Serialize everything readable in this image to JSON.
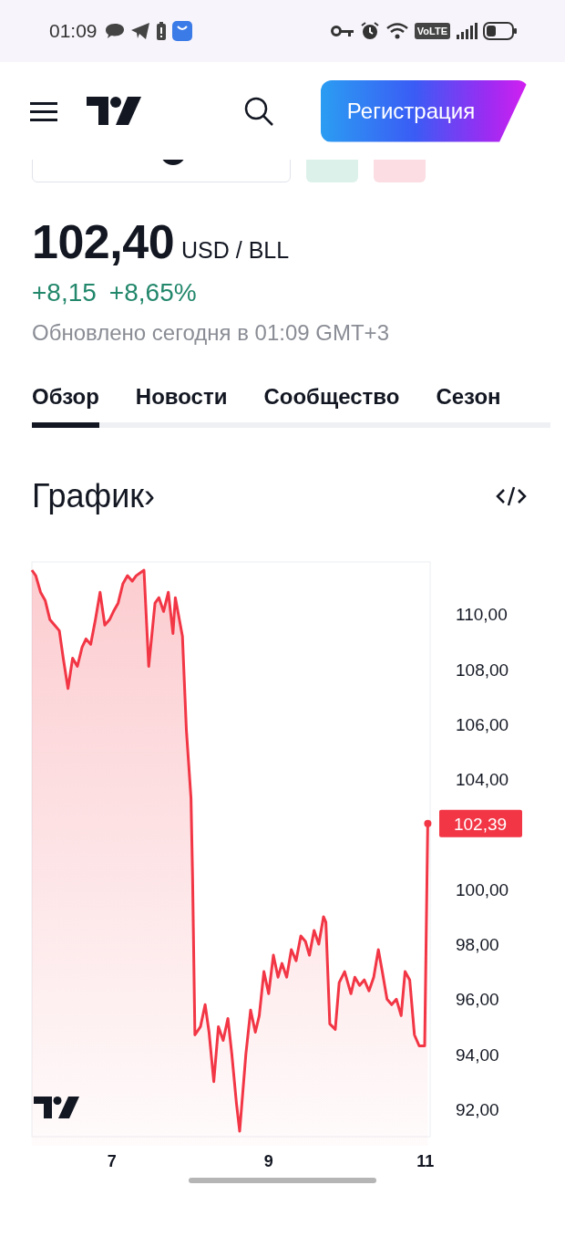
{
  "status_bar": {
    "time": "01:09",
    "network_badge": "VoLTE"
  },
  "header": {
    "register_button": "Регистрация"
  },
  "quote": {
    "price": "102,40",
    "unit": "USD / BLL",
    "change": "+8,15",
    "change_percent": "+8,65%",
    "updated": "Обновлено сегодня в 01:09 GMT+3"
  },
  "tabs": [
    {
      "label": "Обзор",
      "selected": true
    },
    {
      "label": "Новости",
      "selected": false
    },
    {
      "label": "Сообщество",
      "selected": false
    },
    {
      "label": "Сезон",
      "selected": false
    }
  ],
  "chart_section": {
    "title": "График",
    "title_arrow": "›",
    "chart_data": {
      "type": "area",
      "xlim": [
        5.98,
        11.06
      ],
      "ylim": [
        91.0,
        111.9
      ],
      "xticks": [
        {
          "value": 7,
          "label": "7"
        },
        {
          "value": 9,
          "label": "9"
        },
        {
          "value": 11,
          "label": "11"
        }
      ],
      "yticks": [
        {
          "value": 92,
          "label": "92,00"
        },
        {
          "value": 94,
          "label": "94,00"
        },
        {
          "value": 96,
          "label": "96,00"
        },
        {
          "value": 98,
          "label": "98,00"
        },
        {
          "value": 100,
          "label": "100,00"
        },
        {
          "value": 104,
          "label": "104,00"
        },
        {
          "value": 106,
          "label": "106,00"
        },
        {
          "value": 108,
          "label": "108,00"
        },
        {
          "value": 110,
          "label": "110,00"
        }
      ],
      "x": [
        5.98,
        6.03,
        6.09,
        6.15,
        6.21,
        6.27,
        6.33,
        6.38,
        6.44,
        6.5,
        6.56,
        6.62,
        6.67,
        6.73,
        6.79,
        6.85,
        6.91,
        6.97,
        7.02,
        7.08,
        7.14,
        7.2,
        7.26,
        7.31,
        7.41,
        7.47,
        7.55,
        7.6,
        7.66,
        7.72,
        7.78,
        7.81,
        7.9,
        7.95,
        8.01,
        8.03,
        8.06,
        8.13,
        8.19,
        8.24,
        8.3,
        8.36,
        8.42,
        8.48,
        8.53,
        8.59,
        8.63,
        8.71,
        8.77,
        8.83,
        8.88,
        8.94,
        9.0,
        9.06,
        9.12,
        9.17,
        9.23,
        9.29,
        9.35,
        9.41,
        9.47,
        9.52,
        9.58,
        9.64,
        9.7,
        9.73,
        9.78,
        9.85,
        9.9,
        9.97,
        10.05,
        10.1,
        10.16,
        10.22,
        10.28,
        10.34,
        10.4,
        10.45,
        10.51,
        10.57,
        10.63,
        10.69,
        10.74,
        10.8,
        10.86,
        10.92,
        10.99,
        11.03
      ],
      "series": [
        {
          "color": "#f23645",
          "values": [
            111.6,
            111.4,
            110.8,
            110.5,
            109.8,
            109.6,
            109.4,
            108.4,
            107.3,
            108.4,
            108.1,
            108.8,
            109.1,
            108.9,
            109.8,
            110.8,
            109.6,
            109.8,
            110.1,
            110.4,
            111.1,
            111.4,
            111.2,
            111.4,
            111.6,
            108.1,
            110.4,
            110.6,
            110.1,
            110.8,
            109.3,
            110.6,
            109.2,
            105.8,
            103.3,
            100.5,
            94.7,
            95.0,
            95.8,
            94.8,
            93.0,
            95.0,
            94.5,
            95.3,
            94.0,
            92.2,
            91.2,
            94.0,
            95.6,
            94.8,
            95.4,
            97.0,
            96.2,
            97.6,
            96.8,
            97.3,
            96.8,
            97.8,
            97.4,
            98.3,
            98.1,
            97.6,
            98.5,
            98.0,
            99.0,
            98.8,
            95.1,
            94.9,
            96.6,
            97.0,
            96.2,
            96.8,
            96.5,
            96.7,
            96.3,
            96.8,
            97.8,
            97.0,
            96.0,
            95.8,
            96.0,
            95.4,
            97.0,
            96.7,
            94.7,
            94.3,
            94.3,
            102.39
          ]
        }
      ],
      "annotations": [
        {
          "text": "102,39"
        }
      ]
    }
  }
}
